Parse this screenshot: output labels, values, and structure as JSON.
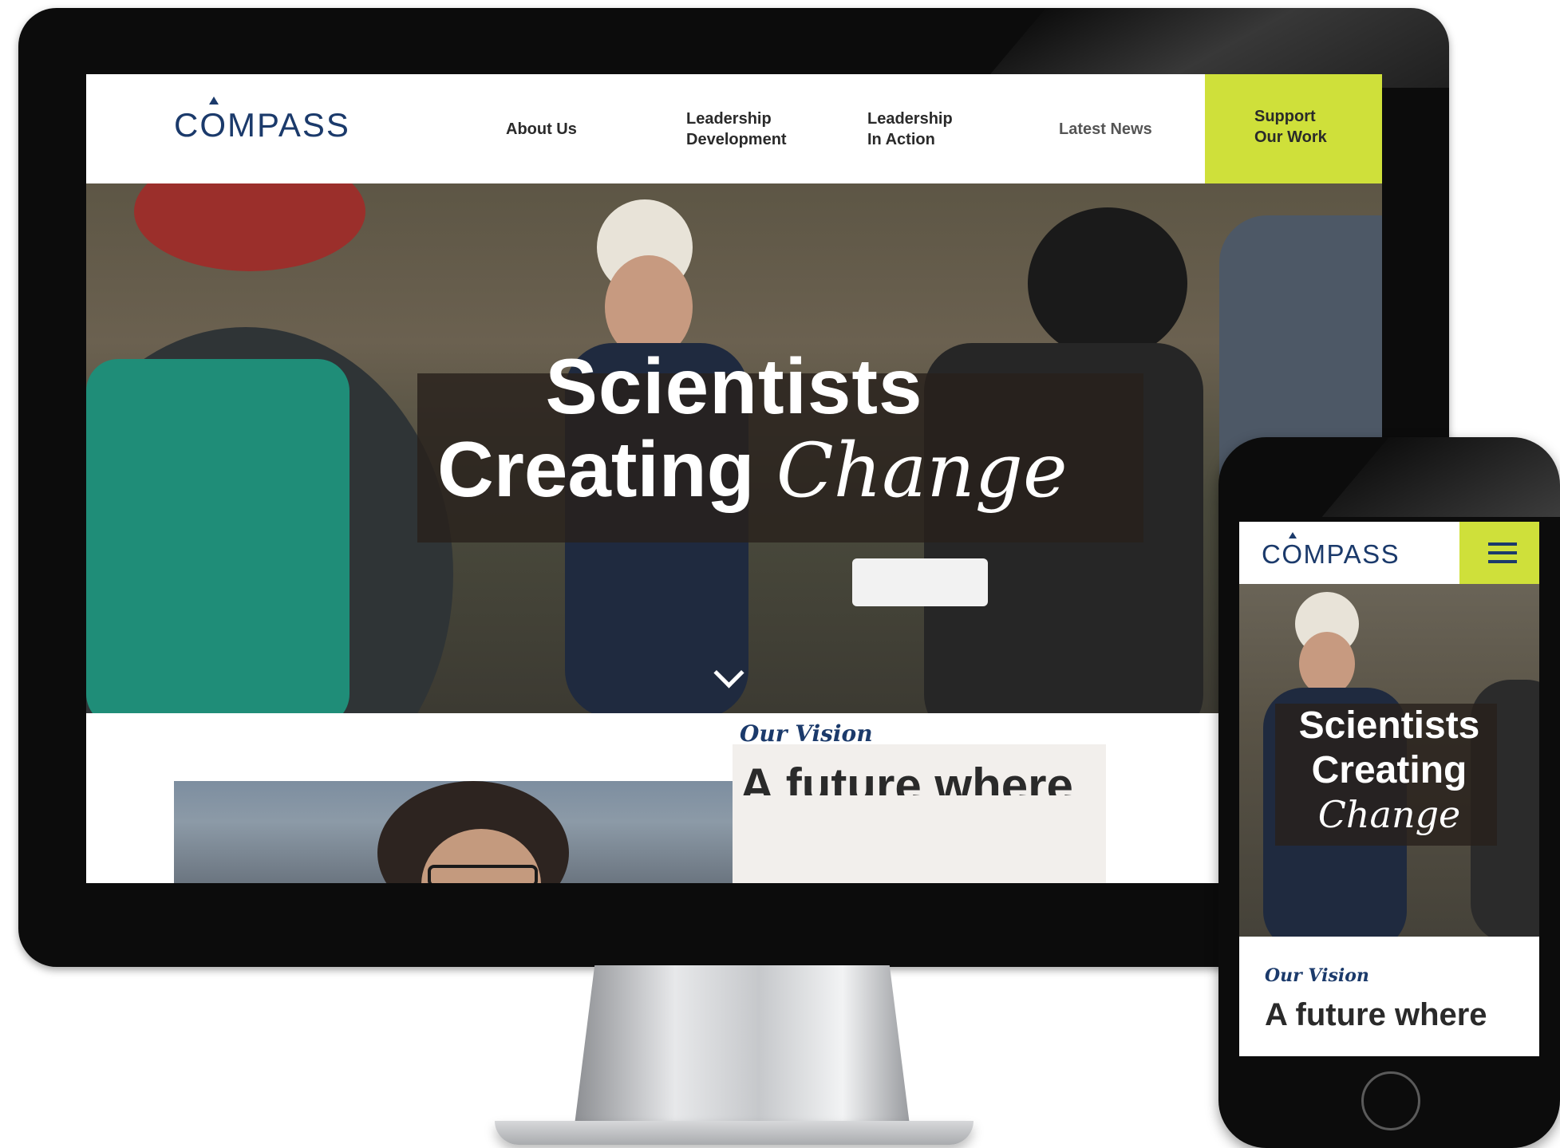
{
  "desktop": {
    "logo": "COMPASS",
    "nav": [
      {
        "line1": "About Us",
        "line2": ""
      },
      {
        "line1": "Leadership",
        "line2": "Development"
      },
      {
        "line1": "Leadership",
        "line2": "In Action"
      },
      {
        "line1": "Latest News",
        "line2": ""
      }
    ],
    "support": {
      "line1": "Support",
      "line2": "Our Work"
    },
    "hero": {
      "line1": "Scientists",
      "line2_plain": "Creating ",
      "line2_italic": "Change"
    },
    "vision": {
      "label": "Our Vision",
      "heading": "A future where"
    }
  },
  "phone": {
    "logo": "COMPASS",
    "hero": {
      "line1": "Scientists",
      "line2": "Creating",
      "line3": "Change"
    },
    "vision": {
      "label": "Our Vision",
      "heading": "A future where"
    }
  },
  "colors": {
    "brand_navy": "#1b3a6b",
    "accent_lime": "#cfe03a",
    "text_dark": "#2a2a2a",
    "card_bg": "#f2efec"
  },
  "icons": [
    "chevron-down-icon",
    "hamburger-menu-icon"
  ]
}
